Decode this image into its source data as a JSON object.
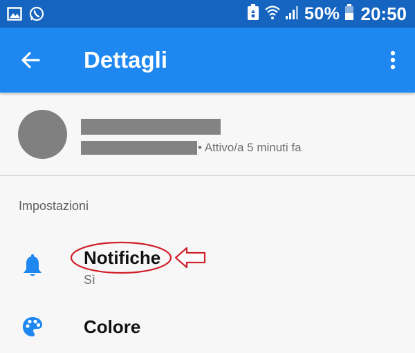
{
  "status_bar": {
    "battery_percent": "50%",
    "time": "20:50",
    "icons": [
      "image-icon",
      "whatsapp-icon",
      "battery-saver-icon",
      "wifi-icon",
      "signal-icon",
      "battery-icon"
    ]
  },
  "app_bar": {
    "title": "Dettagli",
    "color": "#1e88f0"
  },
  "profile": {
    "active_status": "• Attivo/a 5 minuti fa"
  },
  "settings": {
    "section_title": "Impostazioni",
    "items": [
      {
        "label": "Notifiche",
        "value": "Sì",
        "icon": "bell-icon"
      },
      {
        "label": "Colore",
        "icon": "palette-icon"
      }
    ]
  },
  "accent_color": "#1e88f0",
  "annotation_color": "#d0202a"
}
